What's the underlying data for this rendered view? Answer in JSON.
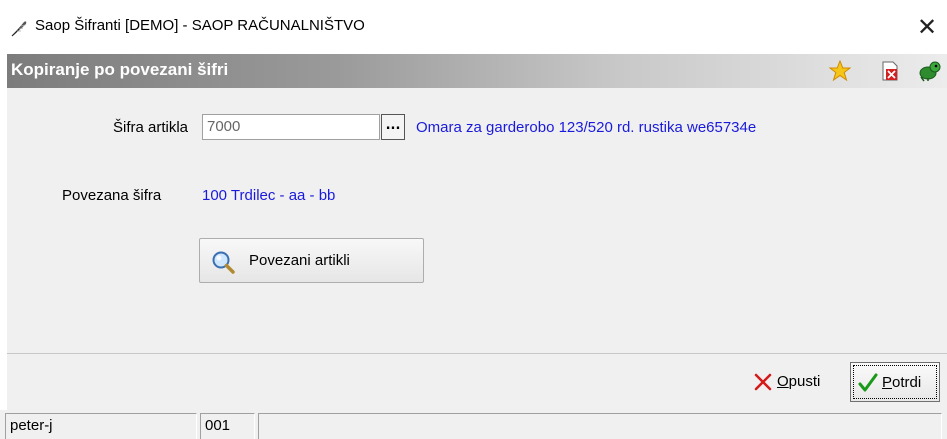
{
  "window": {
    "title": "Saop Šifranti [DEMO] - SAOP RAČUNALNIŠTVO",
    "close_glyph": "✕"
  },
  "header": {
    "title": "Kopiranje po povezani šifri",
    "icons": [
      "star-icon",
      "delete-document-icon",
      "exit-icon"
    ]
  },
  "form": {
    "sifra_label": "Šifra artikla",
    "sifra_value": "7000",
    "browse_label": "...",
    "article_description": "Omara za garderobo 123/520 rd. rustika  we65734e",
    "povezana_label": "Povezana šifra",
    "povezana_value": "100 Trdilec - aa - bb",
    "povezani_button": "Povezani artikli"
  },
  "footer": {
    "cancel_prefix": "O",
    "cancel_rest": "pusti",
    "confirm_prefix": "P",
    "confirm_rest": "otrdi"
  },
  "statusbar": {
    "user": "peter-j",
    "code": "001",
    "extra": ""
  },
  "colors": {
    "accent_link": "#1a1adc",
    "header_gradient_start": "#7c7c7c",
    "cancel_red": "#d41a1a",
    "confirm_green": "#1a9a1a"
  }
}
